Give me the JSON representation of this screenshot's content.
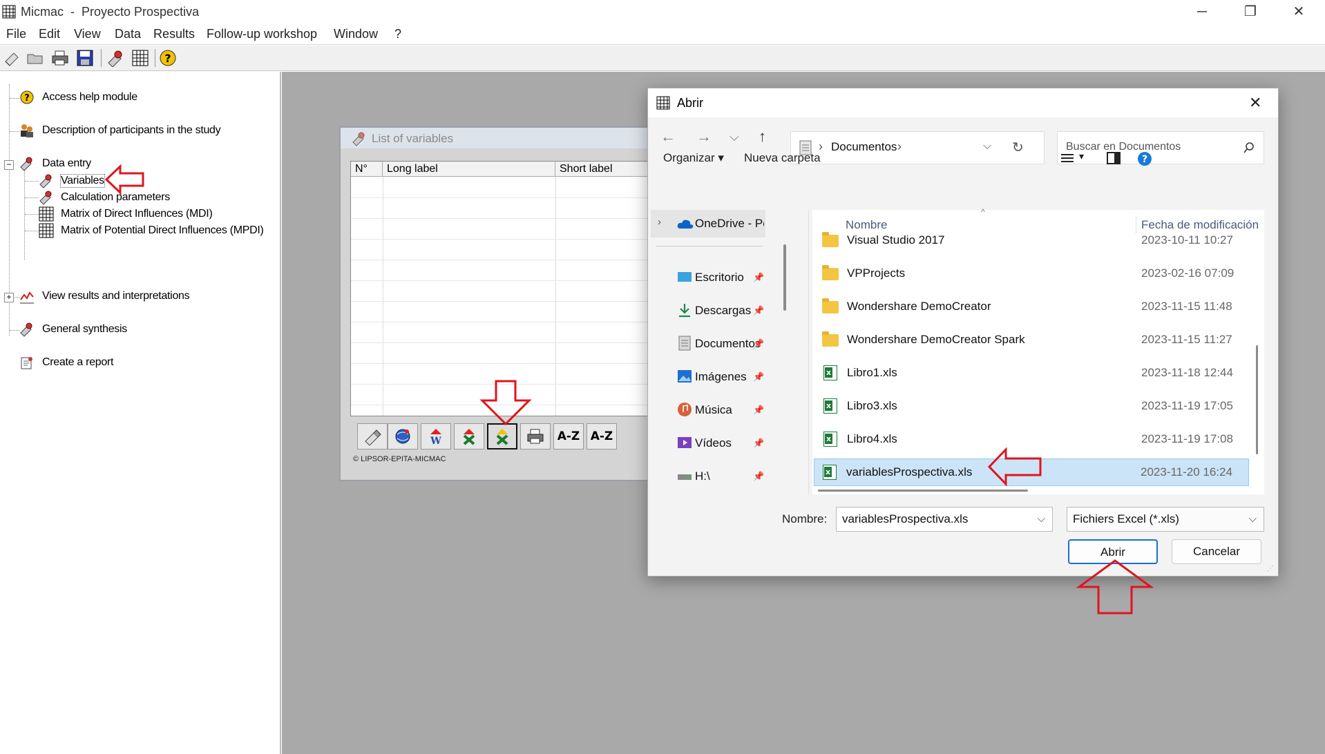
{
  "app": {
    "title": "Micmac  -  Proyecto Prospectiva",
    "window_controls": [
      "─",
      "❐",
      "✕"
    ]
  },
  "menu": [
    "File",
    "Edit",
    "View",
    "Data",
    "Results",
    "Follow-up workshop",
    "Window",
    "?"
  ],
  "toolbar_icons": [
    "new-icon",
    "open-folder-icon",
    "print-icon",
    "save-icon",
    "variables-icon",
    "matrix-icon",
    "help-icon"
  ],
  "tree": {
    "items": [
      {
        "label": "Access help module",
        "icon": "help-icon"
      },
      {
        "label": "Description of participants in the study",
        "icon": "participants-icon"
      },
      {
        "label": "Data entry",
        "icon": "data-entry-icon",
        "expander": "−"
      },
      {
        "label": "Variables",
        "icon": "variables-icon"
      },
      {
        "label": "Calculation parameters",
        "icon": "parameters-icon"
      },
      {
        "label": "Matrix of Direct Influences (MDI)",
        "icon": "matrix-icon"
      },
      {
        "label": "Matrix of Potential Direct Influences (MPDI)",
        "icon": "matrix-icon"
      },
      {
        "label": "View results and interpretations",
        "icon": "chart-icon",
        "expander": "+"
      },
      {
        "label": "General synthesis",
        "icon": "synthesis-icon"
      },
      {
        "label": "Create a report",
        "icon": "report-icon"
      }
    ]
  },
  "variables_window": {
    "title": "List of variables",
    "columns": [
      "N°",
      "Long label",
      "Short label"
    ],
    "buttons": [
      "edit-icon",
      "globe-icon",
      "import-word-icon",
      "delete-icon",
      "import-excel-icon",
      "print-icon",
      "A-Z",
      "A-Z"
    ],
    "copyright": "© LIPSOR-EPITA-MICMAC"
  },
  "dialog": {
    "title": "Abrir",
    "close": "✕",
    "nav": {
      "back": "←",
      "forward": "→",
      "dropdown": "⌵",
      "up": "↑"
    },
    "address": {
      "path": "Documentos",
      "separator": "›",
      "refresh": "↻"
    },
    "search": {
      "placeholder": "Buscar en Documentos"
    },
    "command_bar": {
      "organize": "Organizar",
      "new_folder": "Nueva carpeta",
      "caret": "▾"
    },
    "nav_pane": [
      {
        "label": "OneDrive - Pers",
        "icon": "onedrive-icon"
      },
      {
        "label": "Escritorio",
        "icon": "desktop-icon"
      },
      {
        "label": "Descargas",
        "icon": "downloads-icon"
      },
      {
        "label": "Documentos",
        "icon": "documents-icon"
      },
      {
        "label": "Imágenes",
        "icon": "pictures-icon"
      },
      {
        "label": "Música",
        "icon": "music-icon"
      },
      {
        "label": "Vídeos",
        "icon": "videos-icon"
      },
      {
        "label": "H:\\",
        "icon": "drive-icon"
      }
    ],
    "columns": {
      "name": "Nombre",
      "date": "Fecha de modificación"
    },
    "files": [
      {
        "name": "Visual Studio 2017",
        "date": "2023-10-11 10:27",
        "type": "folder"
      },
      {
        "name": "VPProjects",
        "date": "2023-02-16 07:09",
        "type": "folder"
      },
      {
        "name": "Wondershare DemoCreator",
        "date": "2023-11-15 11:48",
        "type": "folder"
      },
      {
        "name": "Wondershare DemoCreator Spark",
        "date": "2023-11-15 11:27",
        "type": "folder"
      },
      {
        "name": "Libro1.xls",
        "date": "2023-11-18 12:44",
        "type": "xls"
      },
      {
        "name": "Libro3.xls",
        "date": "2023-11-19 17:05",
        "type": "xls"
      },
      {
        "name": "Libro4.xls",
        "date": "2023-11-19 17:08",
        "type": "xls"
      },
      {
        "name": "variablesProspectiva.xls",
        "date": "2023-11-20 16:24",
        "type": "xls",
        "selected": true
      }
    ],
    "filename_label": "Nombre:",
    "filename_value": "variablesProspectiva.xls",
    "filetype_value": "Fichiers Excel (*.xls)",
    "open_button": "Abrir",
    "cancel_button": "Cancelar"
  },
  "colors": {
    "mdi_background": "#a9a9a9",
    "selection": "#cce4f7",
    "annotation_arrow": "#e0141e",
    "accent": "#0a64c8"
  }
}
